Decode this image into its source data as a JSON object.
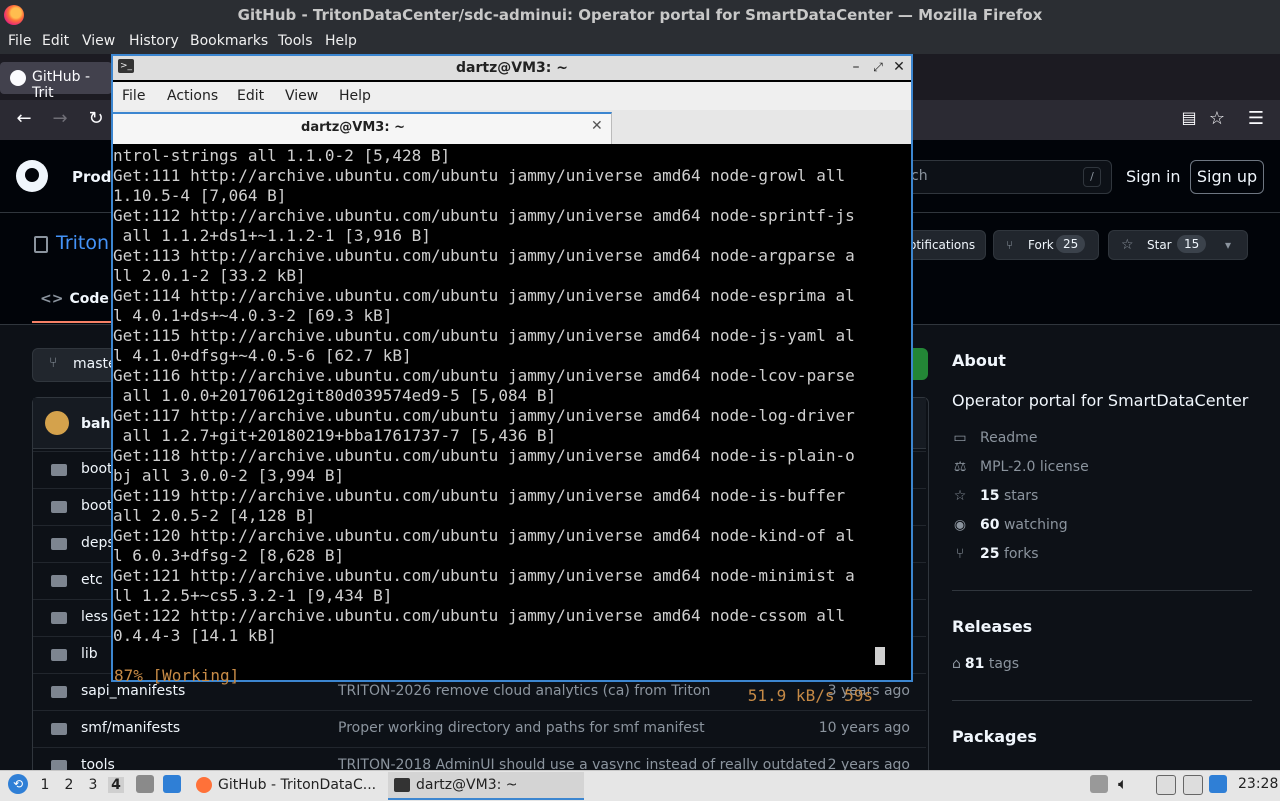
{
  "firefox": {
    "window_title": "GitHub - TritonDataCenter/sdc-adminui: Operator portal for SmartDataCenter — Mozilla Firefox",
    "menu": [
      "File",
      "Edit",
      "View",
      "History",
      "Bookmarks",
      "Tools",
      "Help"
    ],
    "tab_label": "GitHub - Trit"
  },
  "github": {
    "product_label": "Produ",
    "search_placeholder": "ch",
    "search_shortcut": "/",
    "sign_in": "Sign in",
    "sign_up": "Sign up",
    "repo_name_partial": "Triton",
    "notifications_label": "otifications",
    "fork_label": "Fork",
    "fork_count": "25",
    "star_label": "Star",
    "star_count": "15",
    "code_tab": "Code",
    "branch_partial": "maste",
    "commit_author_partial": "baha",
    "files": [
      {
        "name": "boot",
        "message": "",
        "age": ""
      },
      {
        "name": "boots",
        "message": "",
        "age": ""
      },
      {
        "name": "deps",
        "message": "",
        "age": ""
      },
      {
        "name": "etc",
        "message": "",
        "age": ""
      },
      {
        "name": "less",
        "message": "",
        "age": ""
      },
      {
        "name": "lib",
        "message": "",
        "age": ""
      },
      {
        "name": "sapi_manifests",
        "message": "TRITON-2026 remove cloud analytics (ca) from Triton",
        "age": "3 years ago"
      },
      {
        "name": "smf/manifests",
        "message": "Proper working directory and paths for smf manifest",
        "age": "10 years ago"
      },
      {
        "name": "tools",
        "message": "TRITON-2018 AdminUI should use a vasync instead of really outdated",
        "age": "2 years ago"
      }
    ],
    "about": {
      "heading": "About",
      "description": "Operator portal for SmartDataCenter",
      "readme": "Readme",
      "license": "MPL-2.0 license",
      "stars_count": "15",
      "stars_label": "stars",
      "watching_count": "60",
      "watching_label": "watching",
      "forks_count": "25",
      "forks_label": "forks"
    },
    "releases": {
      "heading": "Releases",
      "tags_count": "81",
      "tags_label": "tags"
    },
    "packages": {
      "heading": "Packages"
    }
  },
  "terminal": {
    "title": "dartz@VM3: ~",
    "menu": [
      "File",
      "Actions",
      "Edit",
      "View",
      "Help"
    ],
    "tab_title": "dartz@VM3: ~",
    "lines": [
      "ntrol-strings all 1.1.0-2 [5,428 B]",
      "Get:111 http://archive.ubuntu.com/ubuntu jammy/universe amd64 node-growl all",
      "1.10.5-4 [7,064 B]",
      "Get:112 http://archive.ubuntu.com/ubuntu jammy/universe amd64 node-sprintf-js",
      " all 1.1.2+ds1+~1.1.2-1 [3,916 B]",
      "Get:113 http://archive.ubuntu.com/ubuntu jammy/universe amd64 node-argparse a",
      "ll 2.0.1-2 [33.2 kB]",
      "Get:114 http://archive.ubuntu.com/ubuntu jammy/universe amd64 node-esprima al",
      "l 4.0.1+ds+~4.0.3-2 [69.3 kB]",
      "Get:115 http://archive.ubuntu.com/ubuntu jammy/universe amd64 node-js-yaml al",
      "l 4.1.0+dfsg+~4.0.5-6 [62.7 kB]",
      "Get:116 http://archive.ubuntu.com/ubuntu jammy/universe amd64 node-lcov-parse",
      " all 1.0.0+20170612git80d039574ed9-5 [5,084 B]",
      "Get:117 http://archive.ubuntu.com/ubuntu jammy/universe amd64 node-log-driver",
      " all 1.2.7+git+20180219+bba1761737-7 [5,436 B]",
      "Get:118 http://archive.ubuntu.com/ubuntu jammy/universe amd64 node-is-plain-o",
      "bj all 3.0.0-2 [3,994 B]",
      "Get:119 http://archive.ubuntu.com/ubuntu jammy/universe amd64 node-is-buffer",
      "all 2.0.5-2 [4,128 B]",
      "Get:120 http://archive.ubuntu.com/ubuntu jammy/universe amd64 node-kind-of al",
      "l 6.0.3+dfsg-2 [8,628 B]",
      "Get:121 http://archive.ubuntu.com/ubuntu jammy/universe amd64 node-minimist a",
      "ll 1.2.5+~cs5.3.2-1 [9,434 B]",
      "Get:122 http://archive.ubuntu.com/ubuntu jammy/universe amd64 node-cssom all",
      "0.4.4-3 [14.1 kB]"
    ],
    "status_left": "87% [Working]",
    "status_right": "51.9 kB/s 59s"
  },
  "taskbar": {
    "desktops": [
      "1",
      "2",
      "3",
      "4"
    ],
    "apps": [
      "GitHub - TritonDataC...",
      "dartz@VM3: ~"
    ],
    "clock": "23:28"
  }
}
